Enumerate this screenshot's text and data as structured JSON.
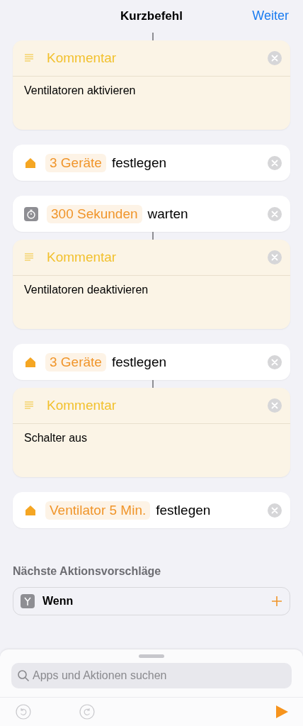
{
  "nav": {
    "title": "Kurzbefehl",
    "action": "Weiter"
  },
  "steps": [
    {
      "kind": "comment",
      "connector": true,
      "title": "Kommentar",
      "text": "Ventilatoren aktivieren"
    },
    {
      "kind": "home",
      "connector": false,
      "token": "3 Geräte",
      "verb": "festlegen"
    },
    {
      "kind": "wait",
      "connector": false,
      "token": "300 Sekunden",
      "verb": "warten"
    },
    {
      "kind": "comment",
      "connector": true,
      "title": "Kommentar",
      "text": "Ventilatoren deaktivieren"
    },
    {
      "kind": "home",
      "connector": false,
      "token": "3 Geräte",
      "verb": "festlegen"
    },
    {
      "kind": "comment",
      "connector": true,
      "title": "Kommentar",
      "text": "Schalter aus"
    },
    {
      "kind": "home",
      "connector": false,
      "token": "Ventilator 5 Min.",
      "verb": "festlegen"
    }
  ],
  "suggestions": {
    "heading": "Nächste Aktionsvorschläge",
    "items": [
      {
        "label": "Wenn"
      }
    ]
  },
  "sheet": {
    "search": {
      "placeholder": "Apps und Aktionen suchen"
    },
    "undo": {
      "disabled": true
    },
    "redo": {
      "disabled": true
    }
  }
}
